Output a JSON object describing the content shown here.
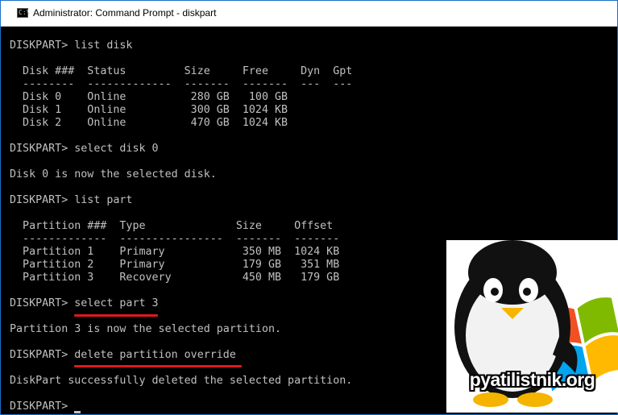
{
  "window": {
    "title": "Administrator: Command Prompt - diskpart",
    "icon": "console-icon",
    "icon_glyph": "C:\\"
  },
  "console": {
    "lines": [
      "DISKPART> list disk",
      "",
      "  Disk ###  Status         Size     Free     Dyn  Gpt",
      "  --------  -------------  -------  -------  ---  ---",
      "  Disk 0    Online          280 GB   100 GB",
      "  Disk 1    Online          300 GB  1024 KB",
      "  Disk 2    Online          470 GB  1024 KB",
      "",
      "DISKPART> select disk 0",
      "",
      "Disk 0 is now the selected disk.",
      "",
      "DISKPART> list part",
      "",
      "  Partition ###  Type              Size     Offset",
      "  -------------  ----------------  -------  -------",
      "  Partition 1    Primary            350 MB  1024 KB",
      "  Partition 2    Primary            179 GB   351 MB",
      "  Partition 3    Recovery           450 MB   179 GB",
      "",
      "DISKPART> select part 3",
      "",
      "Partition 3 is now the selected partition.",
      "",
      "DISKPART> delete partition override",
      "",
      "DiskPart successfully deleted the selected partition.",
      "",
      "DISKPART> "
    ],
    "highlighted_commands": [
      "select part 3",
      "delete partition override"
    ],
    "highlight_color": "#e0181a",
    "text_color": "#c0c0c0",
    "background_color": "#000000"
  },
  "watermark": {
    "text": "pyatilistnik.org",
    "icon": "penguin-windows-logo-icon"
  }
}
